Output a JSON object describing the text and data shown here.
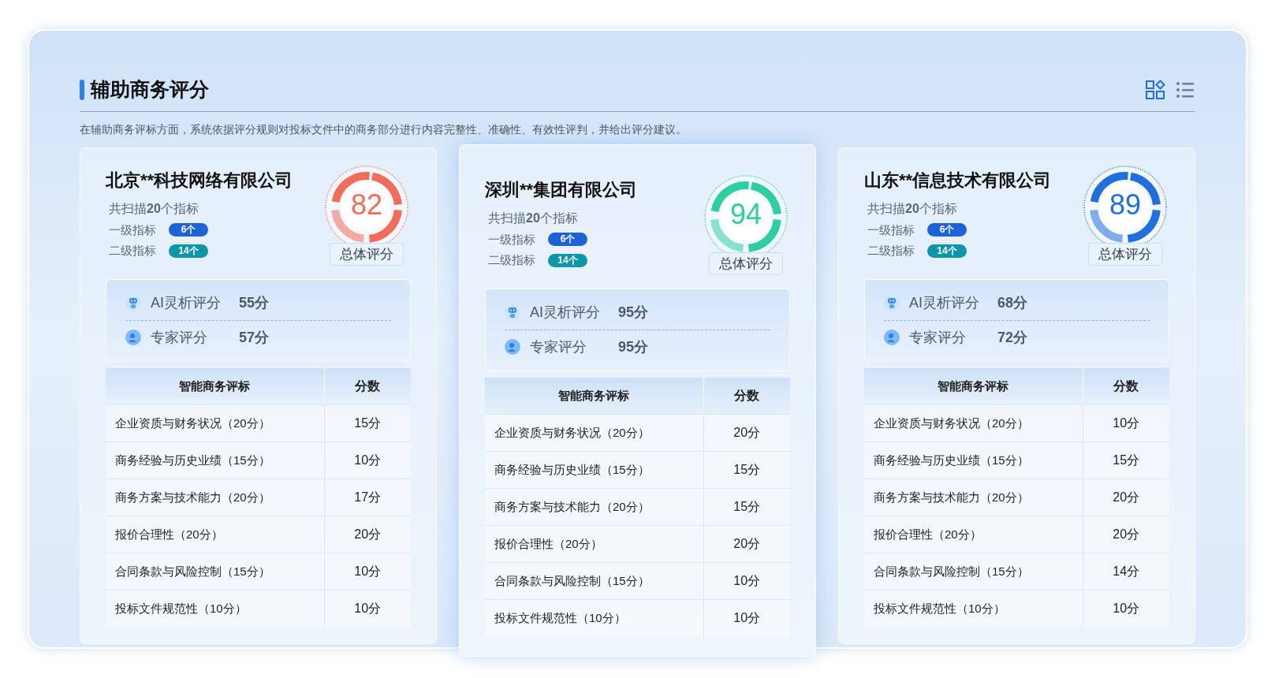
{
  "header": {
    "title": "辅助商务评分",
    "view_toggle": [
      {
        "kind": "grid",
        "selected": true
      },
      {
        "kind": "list",
        "selected": false
      }
    ]
  },
  "description": "在辅助商务评标方面，系统依据评分规则对投标文件中的商务部分进行内容完整性、准确性、有效性评判，并给出评分建议。",
  "cards": [
    {
      "company": "北京**科技网络有限公司",
      "highlighted": false,
      "score": "82",
      "color": "#f26b5b",
      "score_label": "总体评分",
      "scan": "共扫描**20**个指标",
      "indicators": [
        {
          "label": "一级指标",
          "count": "6个",
          "color": "#1d62d9"
        },
        {
          "label": "二级指标",
          "count": "14个",
          "color": "#0e96a8"
        }
      ],
      "sub_scores": [
        {
          "kind": "ai",
          "label": "AI灵析评分",
          "value": "55分"
        },
        {
          "kind": "expert",
          "label": "专家评分",
          "value": "57分"
        }
      ],
      "columns": [
        "智能商务评标",
        "分数"
      ],
      "rows": [
        [
          "企业资质与财务状况（20分）",
          "15分"
        ],
        [
          "商务经验与历史业绩（15分）",
          "10分"
        ],
        [
          "商务方案与技术能力（20分）",
          "17分"
        ],
        [
          "报价合理性（20分）",
          "20分"
        ],
        [
          "合同条款与风险控制（15分）",
          "10分"
        ],
        [
          "投标文件规范性（10分）",
          "10分"
        ]
      ]
    },
    {
      "company": "深圳**集团有限公司",
      "highlighted": true,
      "score": "94",
      "color": "#2ccf9f",
      "score_label": "总体评分",
      "scan": "共扫描**20**个指标",
      "indicators": [
        {
          "label": "一级指标",
          "count": "6个",
          "color": "#1d62d9"
        },
        {
          "label": "二级指标",
          "count": "14个",
          "color": "#0e96a8"
        }
      ],
      "sub_scores": [
        {
          "kind": "ai",
          "label": "AI灵析评分",
          "value": "95分"
        },
        {
          "kind": "expert",
          "label": "专家评分",
          "value": "95分"
        }
      ],
      "columns": [
        "智能商务评标",
        "分数"
      ],
      "rows": [
        [
          "企业资质与财务状况（20分）",
          "20分"
        ],
        [
          "商务经验与历史业绩（15分）",
          "15分"
        ],
        [
          "商务方案与技术能力（20分）",
          "15分"
        ],
        [
          "报价合理性（20分）",
          "20分"
        ],
        [
          "合同条款与风险控制（15分）",
          "10分"
        ],
        [
          "投标文件规范性（10分）",
          "10分"
        ]
      ]
    },
    {
      "company": "山东**信息技术有限公司",
      "highlighted": false,
      "score": "89",
      "color": "#1f6fe0",
      "score_label": "总体评分",
      "scan": "共扫描**20**个指标",
      "indicators": [
        {
          "label": "一级指标",
          "count": "6个",
          "color": "#1d62d9"
        },
        {
          "label": "二级指标",
          "count": "14个",
          "color": "#0e96a8"
        }
      ],
      "sub_scores": [
        {
          "kind": "ai",
          "label": "AI灵析评分",
          "value": "68分"
        },
        {
          "kind": "expert",
          "label": "专家评分",
          "value": "72分"
        }
      ],
      "columns": [
        "智能商务评标",
        "分数"
      ],
      "rows": [
        [
          "企业资质与财务状况（20分）",
          "10分"
        ],
        [
          "商务经验与历史业绩（15分）",
          "15分"
        ],
        [
          "商务方案与技术能力（20分）",
          "20分"
        ],
        [
          "报价合理性（20分）",
          "20分"
        ],
        [
          "合同条款与风险控制（15分）",
          "14分"
        ],
        [
          "投标文件规范性（10分）",
          "10分"
        ]
      ]
    }
  ]
}
